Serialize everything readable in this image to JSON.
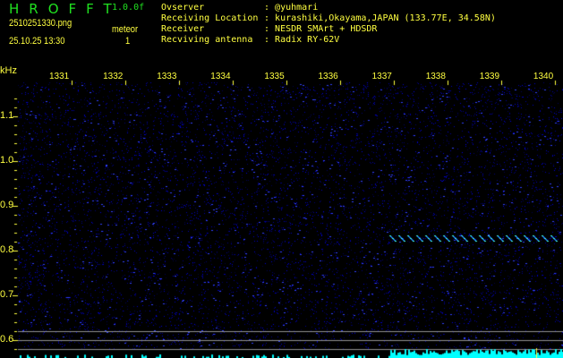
{
  "header": {
    "logo": "HROFFT",
    "version": "1.0.0f",
    "filename": "2510251330.png",
    "datetime": "25.10.25 13:30",
    "count_label": "meteor",
    "count_value": "1",
    "info": [
      {
        "label": "Ovserver",
        "value": "@yuhmari"
      },
      {
        "label": "Receiving Location",
        "value": "kurashiki,Okayama,JAPAN (133.77E, 34.58N)"
      },
      {
        "label": "Receiver",
        "value": "NESDR SMArt + HDSDR"
      },
      {
        "label": "Recviving antenna",
        "value": "Radix RY-62V"
      }
    ]
  },
  "axes": {
    "y_unit": "kHz",
    "x_ticks": [
      "1331",
      "1332",
      "1333",
      "1334",
      "1335",
      "1336",
      "1337",
      "1338",
      "1339",
      "1340"
    ],
    "y_ticks": [
      "1.1",
      "1.0",
      "0.9",
      "0.8",
      "0.7",
      "0.6"
    ]
  },
  "colors": {
    "text": "#ffff40",
    "logo": "#20e020",
    "noise": "#1a20c8",
    "trace": "#40e0ff",
    "hist": "#00ffff",
    "ref_line": "#909090"
  },
  "meteor": {
    "start_minute": 1337.3,
    "end_minute": 1340.3,
    "freq_khz": 0.825
  }
}
